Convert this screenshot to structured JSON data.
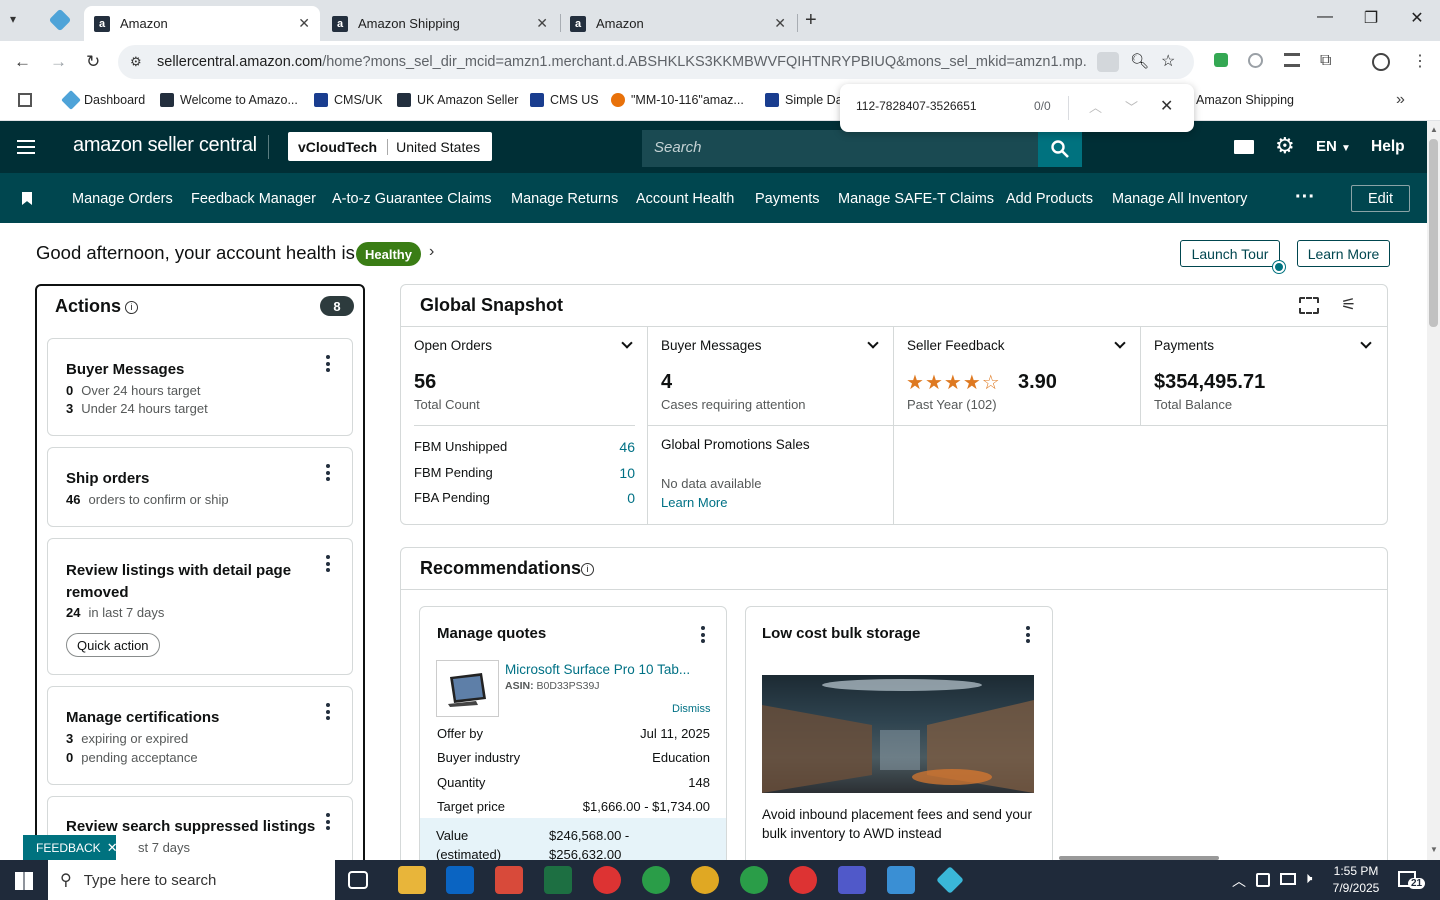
{
  "browser": {
    "tabs": [
      {
        "title": "Amazon",
        "active": true
      },
      {
        "title": "Amazon Shipping",
        "active": false
      },
      {
        "title": "Amazon",
        "active": false
      }
    ],
    "url_host": "sellercentral.amazon.com",
    "url_path": "/home?mons_sel_dir_mcid=amzn1.merchant.d.ABSHKLKS3KKMBWVFQIHTNRYPBIUQ&mons_sel_mkid=amzn1.mp.o.ATVPD...",
    "bookmarks": [
      "Dashboard",
      "Welcome to Amazo...",
      "CMS/UK",
      "UK Amazon Seller",
      "CMS US",
      "\"MM-10-116\"amaz...",
      "Simple Da",
      "Amazon Shipping"
    ],
    "find": {
      "query": "112-7828407-3526651",
      "count": "0/0"
    }
  },
  "header": {
    "logo": "amazon seller central",
    "store": "vCloudTech",
    "marketplace": "United States",
    "search_placeholder": "Search",
    "language": "EN",
    "help": "Help"
  },
  "nav": {
    "items": [
      "Manage Orders",
      "Feedback Manager",
      "A-to-z Guarantee Claims",
      "Manage Returns",
      "Account Health",
      "Payments",
      "Manage SAFE-T Claims",
      "Add Products",
      "Manage All Inventory"
    ],
    "edit": "Edit"
  },
  "greeting": {
    "text": "Good afternoon, your account health is",
    "badge": "Healthy",
    "launch_tour": "Launch Tour",
    "learn_more": "Learn More"
  },
  "actions": {
    "title": "Actions",
    "count": "8",
    "cards": [
      {
        "title": "Buyer Messages",
        "lines": [
          {
            "num": "0",
            "text": "Over 24 hours target"
          },
          {
            "num": "3",
            "text": "Under 24 hours target"
          }
        ]
      },
      {
        "title": "Ship orders",
        "lines": [
          {
            "num": "46",
            "text": "orders to confirm or ship"
          }
        ]
      },
      {
        "title": "Review listings with detail page removed",
        "lines": [
          {
            "num": "24",
            "text": "in last 7 days"
          }
        ],
        "button": "Quick action"
      },
      {
        "title": "Manage certifications",
        "lines": [
          {
            "num": "3",
            "text": "expiring or expired"
          },
          {
            "num": "0",
            "text": "pending acceptance"
          }
        ]
      },
      {
        "title": "Review search suppressed listings",
        "lines": [
          {
            "num": "",
            "text": "st 7 days"
          }
        ]
      }
    ],
    "feedback": "FEEDBACK"
  },
  "snapshot": {
    "title": "Global Snapshot",
    "open_orders": {
      "label": "Open Orders",
      "value": "56",
      "sub": "Total Count",
      "rows": [
        {
          "label": "FBM Unshipped",
          "value": "46"
        },
        {
          "label": "FBM Pending",
          "value": "10"
        },
        {
          "label": "FBA Pending",
          "value": "0"
        }
      ]
    },
    "buyer_messages": {
      "label": "Buyer Messages",
      "value": "4",
      "sub": "Cases requiring attention"
    },
    "promotions": {
      "label": "Global Promotions Sales",
      "nodata": "No data available",
      "link": "Learn More"
    },
    "seller_feedback": {
      "label": "Seller Feedback",
      "value": "3.90",
      "sub": "Past Year (102)",
      "stars": 3.9
    },
    "payments": {
      "label": "Payments",
      "value": "$354,495.71",
      "sub": "Total Balance"
    }
  },
  "recommendations": {
    "title": "Recommendations",
    "quotes": {
      "title": "Manage quotes",
      "product": "Microsoft Surface Pro 10 Tab...",
      "asin_label": "ASIN:",
      "asin": "B0D33PS39J",
      "dismiss": "Dismiss",
      "rows": [
        {
          "label": "Offer by",
          "value": "Jul 11, 2025"
        },
        {
          "label": "Buyer industry",
          "value": "Education"
        },
        {
          "label": "Quantity",
          "value": "148"
        },
        {
          "label": "Target price",
          "value": "$1,666.00 - $1,734.00"
        }
      ],
      "value_label": "Value (estimated)",
      "value_range": "$246,568.00 - $256,632.00"
    },
    "storage": {
      "title": "Low cost bulk storage",
      "text": "Avoid inbound placement fees and send your bulk inventory to AWD instead"
    }
  },
  "taskbar": {
    "search": "Type here to search",
    "time": "1:55 PM",
    "date": "7/9/2025",
    "notif": "21"
  }
}
